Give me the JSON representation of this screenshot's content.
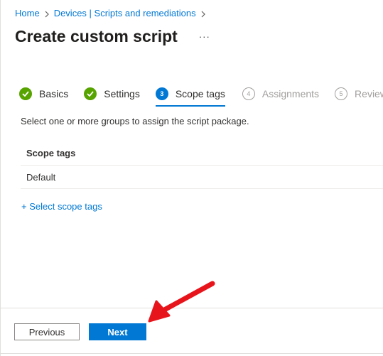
{
  "breadcrumb": {
    "home": "Home",
    "section": "Devices | Scripts and remediations"
  },
  "header": {
    "title": "Create custom script",
    "more": "···"
  },
  "wizard": {
    "steps": [
      {
        "number": "1",
        "label": "Basics",
        "state": "done"
      },
      {
        "number": "2",
        "label": "Settings",
        "state": "done"
      },
      {
        "number": "3",
        "label": "Scope tags",
        "state": "current"
      },
      {
        "number": "4",
        "label": "Assignments",
        "state": "future"
      },
      {
        "number": "5",
        "label": "Review + add",
        "state": "future"
      }
    ]
  },
  "main": {
    "instructions": "Select one or more groups to assign the script package.",
    "table_header": "Scope tags",
    "rows": [
      "Default"
    ],
    "select_link": "+ Select scope tags"
  },
  "footer": {
    "previous_label": "Previous",
    "next_label": "Next"
  },
  "colors": {
    "accent": "#0078d4",
    "success": "#57a300",
    "annotation_arrow": "#e8141b"
  },
  "icons": {
    "breadcrumb_separator": "chevron-right-icon",
    "done_step": "checkmark-circle-icon",
    "annotation": "red-arrow-annotation"
  }
}
